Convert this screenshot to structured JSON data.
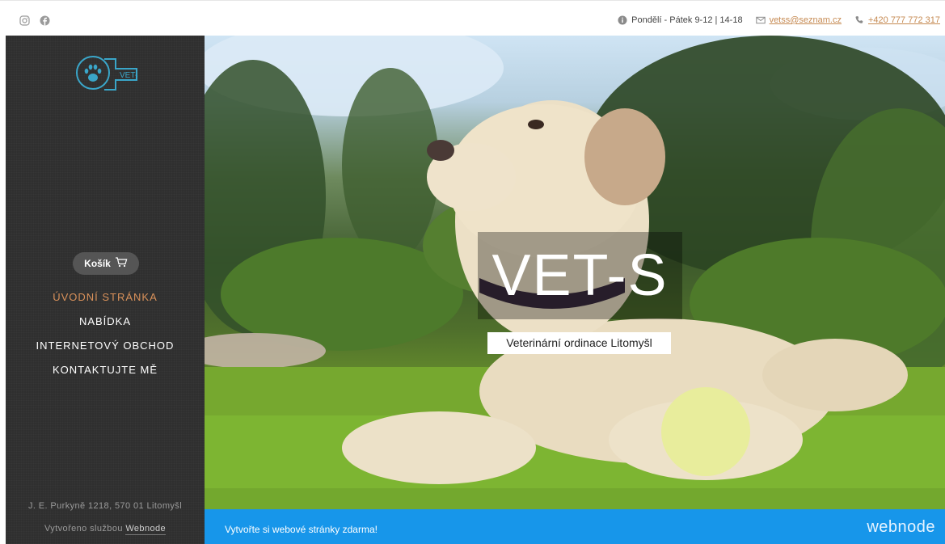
{
  "topbar": {
    "social": [
      "instagram-icon",
      "facebook-icon"
    ],
    "hours": "Pondělí - Pátek 9-12 | 14-18",
    "email": "vetss@seznam.cz",
    "phone": "+420 777 772 317"
  },
  "sidebar": {
    "logo_text": "VET-S",
    "cart_label": "Košík",
    "nav": [
      {
        "label": "ÚVODNÍ STRÁNKA",
        "active": true
      },
      {
        "label": "NABÍDKA",
        "active": false
      },
      {
        "label": "INTERNETOVÝ OBCHOD",
        "active": false
      },
      {
        "label": "KONTAKTUJTE MĚ",
        "active": false
      }
    ],
    "address": "J. E. Purkyně 1218, 570 01 Litomyšl",
    "made_prefix": "Vytvořeno službou",
    "made_link": "Webnode"
  },
  "hero": {
    "title": "VET-S",
    "subtitle": "Veterinární ordinace Litomyšl"
  },
  "banner": {
    "text": "Vytvořte si webové stránky zdarma!",
    "brand": "webnode"
  },
  "colors": {
    "accent": "#d9915a",
    "link": "#c68a52",
    "banner": "#1796ea",
    "sidebar": "#2f2f2f",
    "logo": "#3aa6c9"
  }
}
